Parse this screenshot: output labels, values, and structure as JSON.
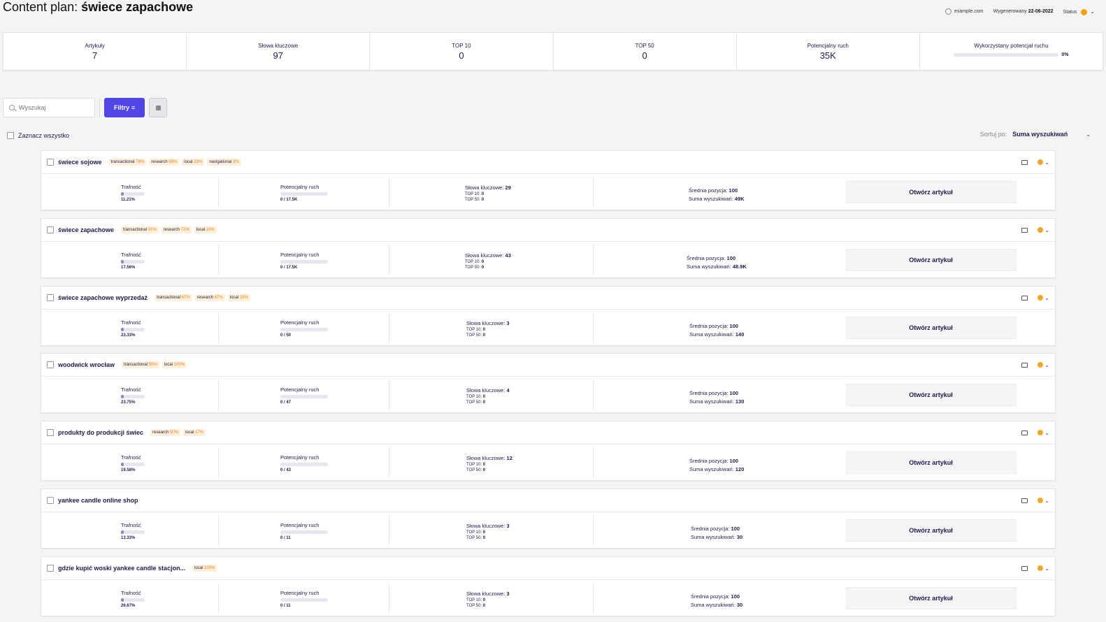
{
  "header": {
    "prefix": "Content plan:",
    "title": "świece zapachowe"
  },
  "meta": {
    "domain": "example.com",
    "generated_label": "Wygenerowany",
    "generated_date": "22-06-2022",
    "status_label": "Status",
    "status_color": "#f59e0b"
  },
  "stats": {
    "articles": {
      "label": "Artykuły",
      "value": "7"
    },
    "keywords": {
      "label": "Słowa kluczowe",
      "value": "97"
    },
    "top10": {
      "label": "TOP 10",
      "value": "0"
    },
    "top50": {
      "label": "TOP 50",
      "value": "0"
    },
    "traffic": {
      "label": "Potencjalny ruch",
      "value": "35K"
    },
    "used": {
      "label": "Wykorzystany potencjał ruchu",
      "value": "0%"
    }
  },
  "toolbar": {
    "search_placeholder": "Wyszukaj",
    "filter_label": "Filtry",
    "filter_icon": "≡"
  },
  "select_all": {
    "label": "Zaznacz wszystko"
  },
  "sort": {
    "label": "Sortuj po:",
    "value": "Suma wyszukiwań"
  },
  "labels": {
    "relevance": "Trafność",
    "traffic": "Potencjalny ruch",
    "keywords": "Słowa kluczowe:",
    "top10": "TOP 10:",
    "top50": "TOP 50:",
    "avg_pos": "Średnia pozycja:",
    "sum_search": "Suma wyszukiwań:",
    "open": "Otwórz artykuł"
  },
  "articles": [
    {
      "title": "świece sojowe",
      "tags": [
        [
          "transactional",
          "76%"
        ],
        [
          "research",
          "66%"
        ],
        [
          "local",
          "28%"
        ],
        [
          "navigational",
          "3%"
        ]
      ],
      "relevance": "11.21%",
      "traffic": "0 / 17.5K",
      "keywords": "29",
      "top10": "0",
      "top50": "0",
      "avg_pos": "100",
      "sum_search": "49K"
    },
    {
      "title": "świece zapachowe",
      "tags": [
        [
          "transactional",
          "91%"
        ],
        [
          "research",
          "72%"
        ],
        [
          "local",
          "16%"
        ]
      ],
      "relevance": "17.56%",
      "traffic": "0 / 17.5K",
      "keywords": "43",
      "top10": "0",
      "top50": "0",
      "avg_pos": "100",
      "sum_search": "48.9K"
    },
    {
      "title": "świece zapachowe wyprzedaż",
      "tags": [
        [
          "transactional",
          "67%"
        ],
        [
          "research",
          "67%"
        ],
        [
          "local",
          "33%"
        ]
      ],
      "relevance": "23.33%",
      "traffic": "0 / 50",
      "keywords": "3",
      "top10": "0",
      "top50": "0",
      "avg_pos": "100",
      "sum_search": "140"
    },
    {
      "title": "woodwick wrocław",
      "tags": [
        [
          "transactional",
          "50%"
        ],
        [
          "local",
          "100%"
        ]
      ],
      "relevance": "23.75%",
      "traffic": "0 / 47",
      "keywords": "4",
      "top10": "0",
      "top50": "0",
      "avg_pos": "100",
      "sum_search": "130"
    },
    {
      "title": "produkty do produkcji świec",
      "tags": [
        [
          "research",
          "50%"
        ],
        [
          "local",
          "17%"
        ]
      ],
      "relevance": "19.58%",
      "traffic": "0 / 43",
      "keywords": "12",
      "top10": "0",
      "top50": "0",
      "avg_pos": "100",
      "sum_search": "120"
    },
    {
      "title": "yankee candle online shop",
      "tags": [],
      "relevance": "13.33%",
      "traffic": "0 / 11",
      "keywords": "3",
      "top10": "0",
      "top50": "0",
      "avg_pos": "100",
      "sum_search": "30"
    },
    {
      "title": "gdzie kupić woski yankee candle stacjon...",
      "tags": [
        [
          "local",
          "100%"
        ]
      ],
      "relevance": "26.67%",
      "traffic": "0 / 11",
      "keywords": "3",
      "top10": "0",
      "top50": "0",
      "avg_pos": "100",
      "sum_search": "30"
    }
  ]
}
